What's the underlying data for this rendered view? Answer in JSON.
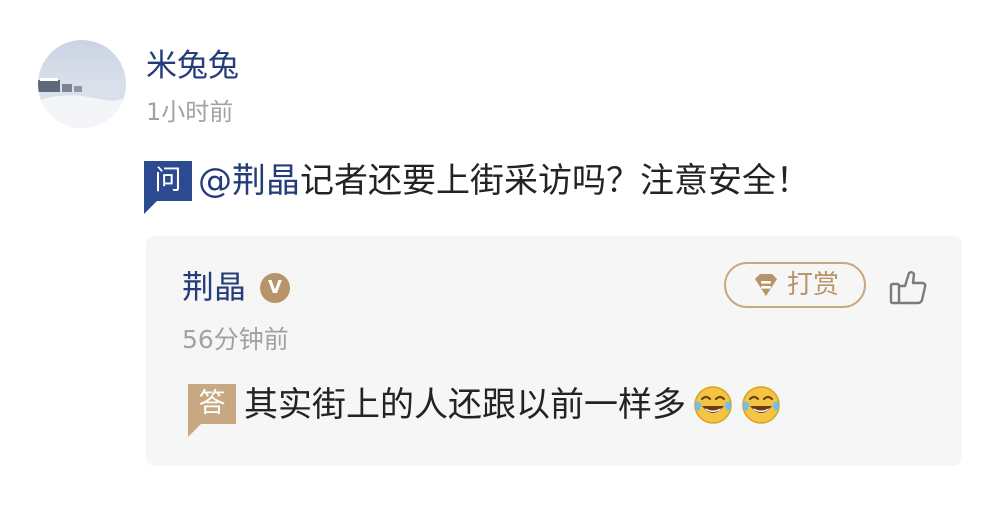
{
  "question": {
    "user": {
      "name": "米兔兔",
      "time": "1小时前",
      "avatar_icon": "snowy-mountain-avatar"
    },
    "tag": "问",
    "mention": "@荆晶",
    "text": "记者还要上街采访吗？注意安全！"
  },
  "answer": {
    "user": {
      "name": "荆晶",
      "time": "56分钟前",
      "verified_badge": "V"
    },
    "tip_button": {
      "label": "打赏",
      "icon": "diamond-gift-icon"
    },
    "like_icon": "thumbs-up-icon",
    "tag": "答",
    "text": "其实街上的人还跟以前一样多",
    "emojis": [
      "tears-of-joy-emoji",
      "tears-of-joy-emoji"
    ]
  },
  "colors": {
    "name_blue": "#253c7a",
    "question_tag": "#2b4a8f",
    "answer_tag": "#c8a882",
    "time_gray": "#a2a2a2",
    "card_bg": "#f6f6f6"
  }
}
